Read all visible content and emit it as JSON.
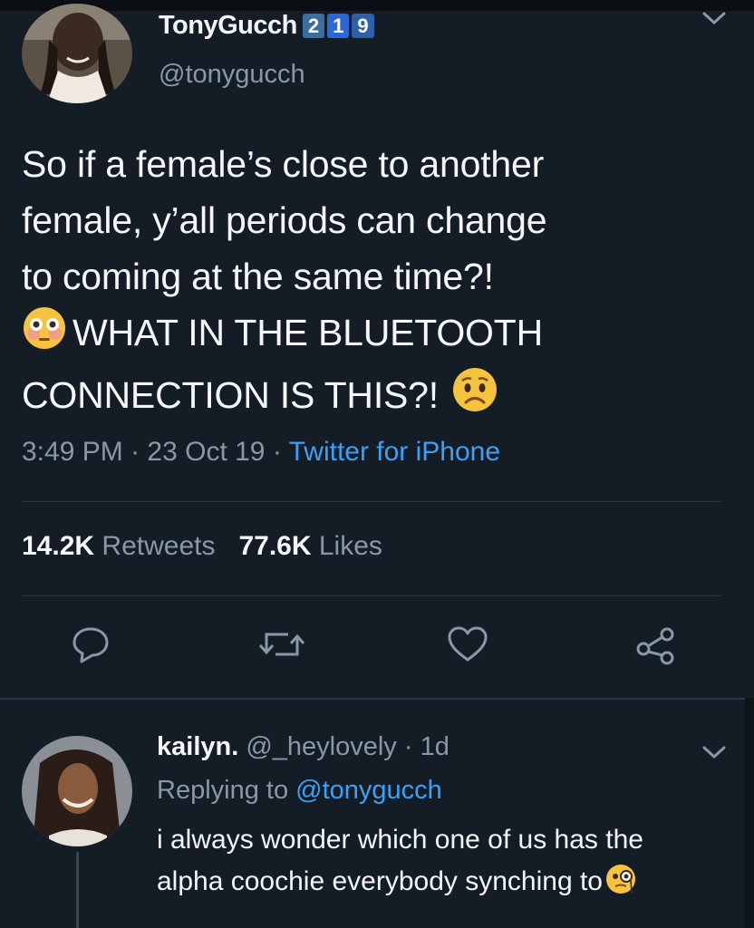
{
  "tweet": {
    "display_name": "TonyGucch",
    "badges": [
      "2",
      "1",
      "9"
    ],
    "handle": "@tonygucch",
    "body_lines": [
      "So if a female’s close to another",
      "female, y’all periods can change",
      "to coming at the same time?!",
      "WHAT IN THE BLUETOOTH",
      "CONNECTION IS THIS?!"
    ],
    "emoji_names": [
      "flushed-face-emoji",
      "worried-face-emoji"
    ],
    "time": "3:49 PM",
    "dot1": " · ",
    "date": "23 Oct 19",
    "dot2": " · ",
    "source": "Twitter for iPhone",
    "retweets_count": "14.2K",
    "retweets_label": "Retweets",
    "likes_count": "77.6K",
    "likes_label": "Likes"
  },
  "actions": {
    "icons": [
      "reply-icon",
      "retweet-icon",
      "like-icon",
      "share-icon"
    ]
  },
  "reply": {
    "display_name": "kailyn.",
    "handle": " @_heylovely · 1d",
    "replying_prefix": "Replying to ",
    "replying_to": "@tonygucch",
    "text_lines": [
      "i always wonder which one of us has the",
      "alpha coochie everybody synching to"
    ],
    "emoji_name": "face-with-monocle-emoji"
  },
  "colors": {
    "background": "#141d26",
    "text": "#f4f6f8",
    "secondary": "#8899a6",
    "link": "#3d9ff5",
    "divider": "#2b3743"
  }
}
